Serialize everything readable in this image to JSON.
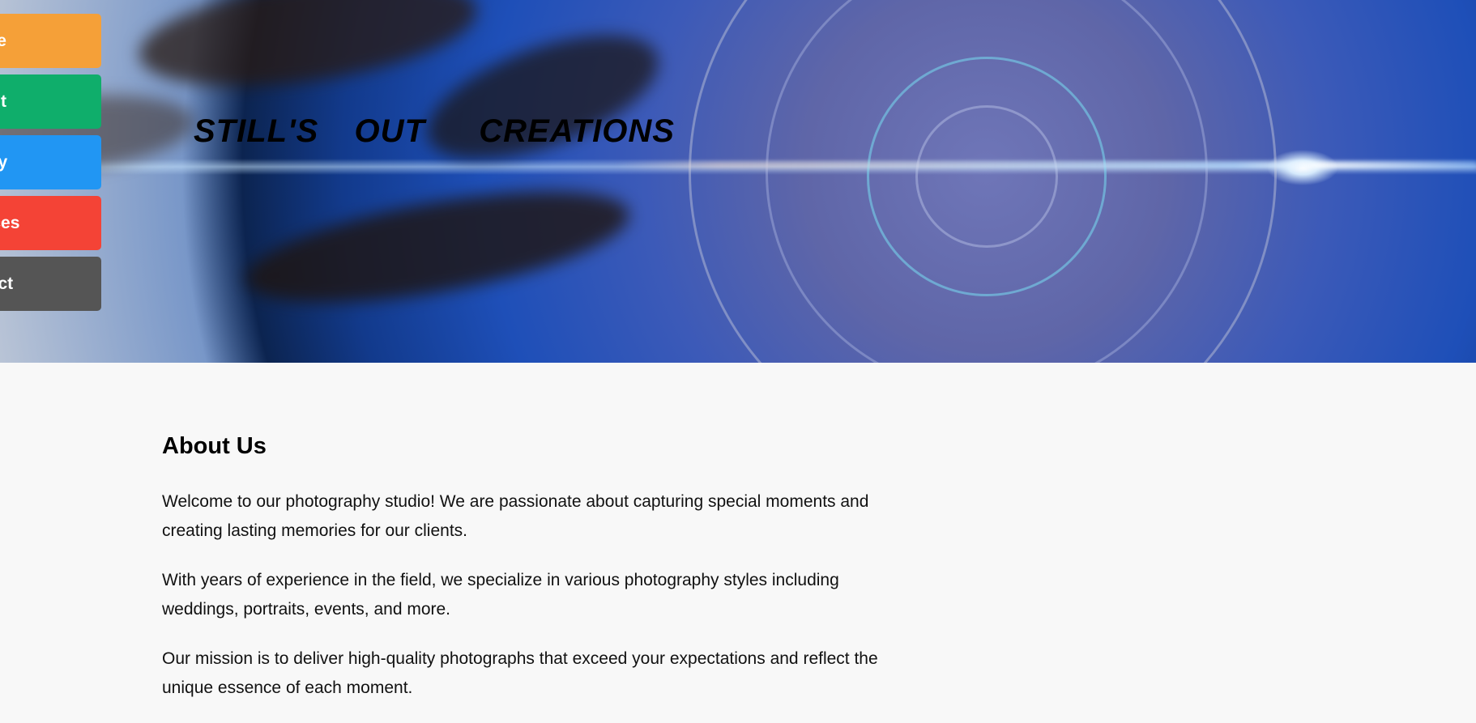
{
  "header": {
    "title": "STILL'S  OUT   CREATIONS"
  },
  "nav": {
    "items": [
      {
        "label": "Home",
        "color": "#f5a038"
      },
      {
        "label": "About",
        "color": "#0fae6b"
      },
      {
        "label": "Gallery",
        "color": "#2196f3"
      },
      {
        "label": "Services",
        "color": "#f44336"
      },
      {
        "label": "Contact",
        "color": "#555555"
      }
    ]
  },
  "about": {
    "heading": "About Us",
    "paragraphs": [
      "Welcome to our photography studio! We are passionate about capturing special moments and creating lasting memories for our clients.",
      "With years of experience in the field, we specialize in various photography styles including weddings, portraits, events, and more.",
      "Our mission is to deliver high-quality photographs that exceed your expectations and reflect the unique essence of each moment."
    ]
  }
}
